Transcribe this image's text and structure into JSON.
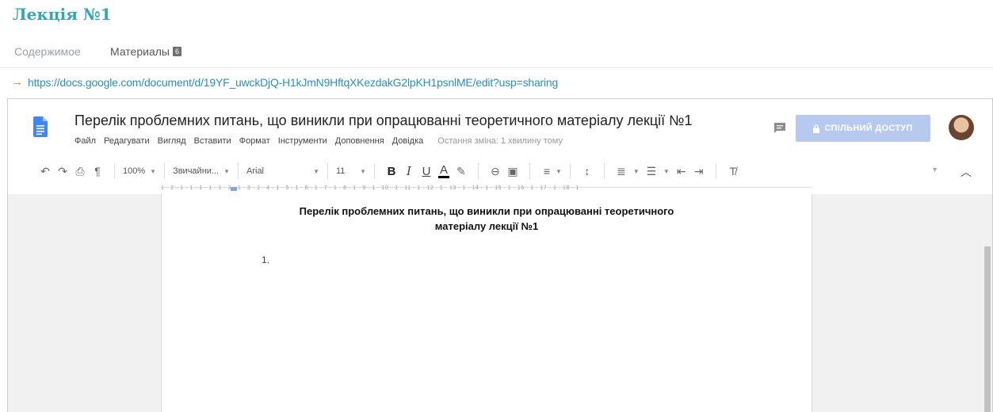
{
  "lecture": {
    "title": "Лекція №1"
  },
  "tabs": [
    {
      "label": "Содержимое"
    },
    {
      "label": "Материалы",
      "badge": "6"
    }
  ],
  "link": {
    "url": "https://docs.google.com/document/d/19YF_uwckDjQ-H1kJmN9HftqXKezdakG2lpKH1psnlME/edit?usp=sharing"
  },
  "doc": {
    "title": "Перелік проблемних питань, що виникли при опрацюванні теоретичного матеріалу лекції №1",
    "menu": [
      "Файл",
      "Редагувати",
      "Вигляд",
      "Вставити",
      "Формат",
      "Інструменти",
      "Доповнення",
      "Довідка"
    ],
    "last_edit": "Остання зміна: 1 хвилину тому",
    "share_label": "СПІЛЬНИЙ ДОСТУП"
  },
  "toolbar": {
    "zoom": "100%",
    "style": "Звичайни...",
    "font": "Arial",
    "size": "11",
    "bold": "B",
    "italic": "I",
    "underline": "U",
    "text_color": "A"
  },
  "ruler": {
    "text": "1 · 2 · 1 · 1 · 1 · 1 · 1 · 2 · 1 · 3 · 1 · 4 · 1 · 5 · 1 · 6 · 1 · 7 · 1 · 8 · 1 · 9 · 1 · 10 · 1 · 11 · 1 · 12 · 1 · 13 · 1 · 14 · 1 · 15 · 1 · 16 · 1 · 17 · 1 · 18 · 1"
  },
  "page": {
    "heading_line1": "Перелік проблемних питань, що виникли при опрацюванні теоретичного",
    "heading_line2": "матеріалу лекції №1",
    "list_number": "1."
  },
  "colors": {
    "accent": "#2fa7b8",
    "link": "#2a8fbd",
    "arrow": "#e8862e",
    "share": "#b8c9ef",
    "docs_blue": "#4285f4"
  },
  "icons": [
    "arrow-right-icon",
    "google-docs-icon",
    "comment-icon",
    "lock-icon",
    "undo-icon",
    "redo-icon",
    "print-icon",
    "paint-format-icon",
    "highlighter-icon",
    "link-icon",
    "image-icon",
    "align-icon",
    "line-spacing-icon",
    "numbered-list-icon",
    "bulleted-list-icon",
    "decrease-indent-icon",
    "increase-indent-icon",
    "clear-formatting-icon",
    "chevron-up-icon"
  ]
}
